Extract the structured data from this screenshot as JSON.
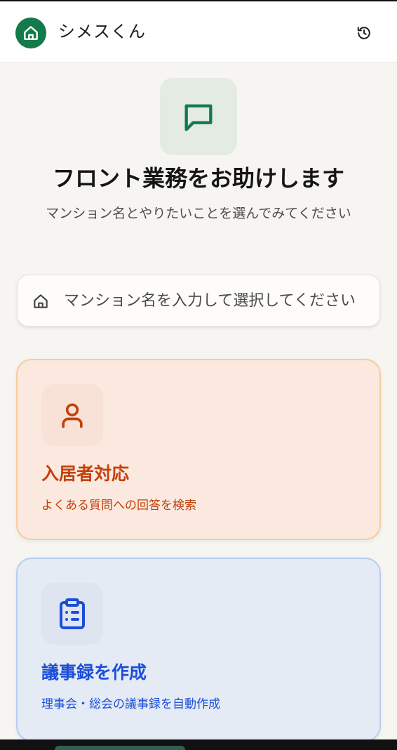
{
  "header": {
    "app_title": "シメスくん",
    "logo_icon": "home-icon",
    "history_icon": "history-icon",
    "brand_color": "#127a4b"
  },
  "hero": {
    "icon": "message-square-icon",
    "title": "フロント業務をお助けします",
    "subtitle": "マンション名とやりたいことを選んでみてください"
  },
  "search": {
    "icon": "home-icon",
    "placeholder": "マンション名を入力して選択してください",
    "value": ""
  },
  "cards": [
    {
      "icon": "user-icon",
      "title": "入居者対応",
      "description": "よくある質問への回答を検索",
      "accent_color": "#c2410c"
    },
    {
      "icon": "clipboard-list-icon",
      "title": "議事録を作成",
      "description": "理事会・総会の議事録を自動作成",
      "accent_color": "#1d4ed8"
    }
  ]
}
